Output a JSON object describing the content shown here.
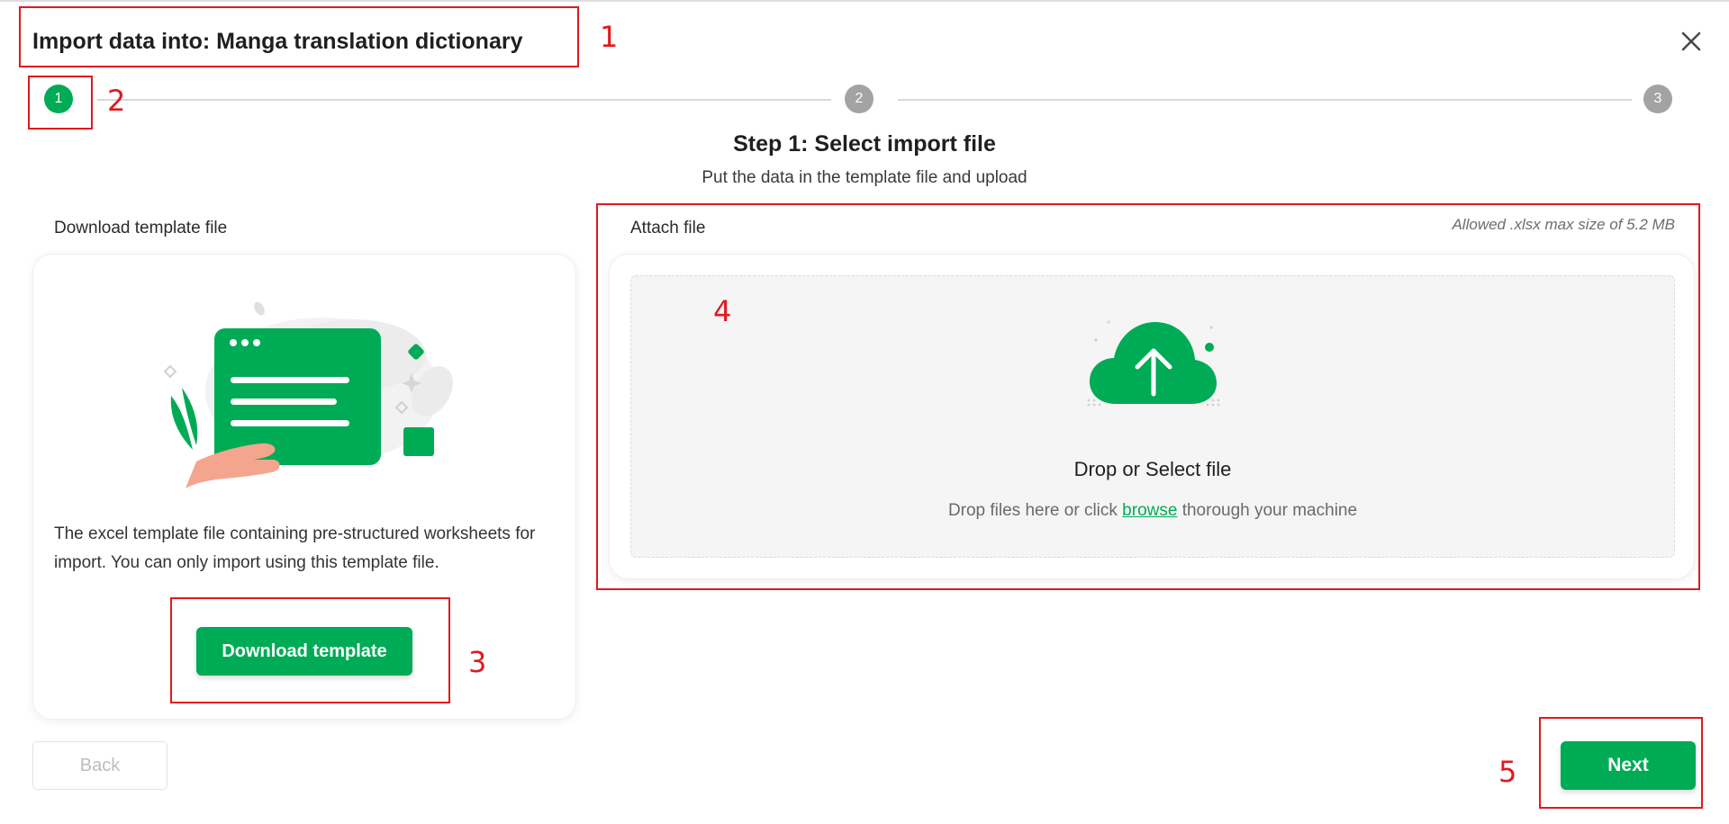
{
  "dialog": {
    "title": "Import data into: Manga translation dictionary",
    "close_icon": "close-icon"
  },
  "stepper": {
    "steps": [
      {
        "number": "1",
        "state": "active"
      },
      {
        "number": "2",
        "state": "inactive"
      },
      {
        "number": "3",
        "state": "inactive"
      }
    ]
  },
  "step": {
    "title": "Step 1: Select import file",
    "subtitle": "Put the data in the template file and upload"
  },
  "download_section": {
    "label": "Download template file",
    "description": "The excel template file containing pre-structured worksheets for import. You can only import using this template file.",
    "button_label": "Download template",
    "illustration_icon": "spreadsheet-template-illustration"
  },
  "attach_section": {
    "label": "Attach file",
    "allowed_text": "Allowed .xlsx max size of 5.2 MB",
    "drop_title": "Drop or Select file",
    "drop_text_before": "Drop files here or click ",
    "drop_link": "browse",
    "drop_text_after": " thorough your machine",
    "upload_icon": "cloud-upload-icon"
  },
  "footer": {
    "back_label": "Back",
    "next_label": "Next"
  },
  "annotations": {
    "labels": [
      "1",
      "2",
      "3",
      "4",
      "5"
    ]
  },
  "colors": {
    "accent": "#00ab55",
    "inactive_step": "#a3a3a3",
    "annotation": "#e0191f"
  }
}
